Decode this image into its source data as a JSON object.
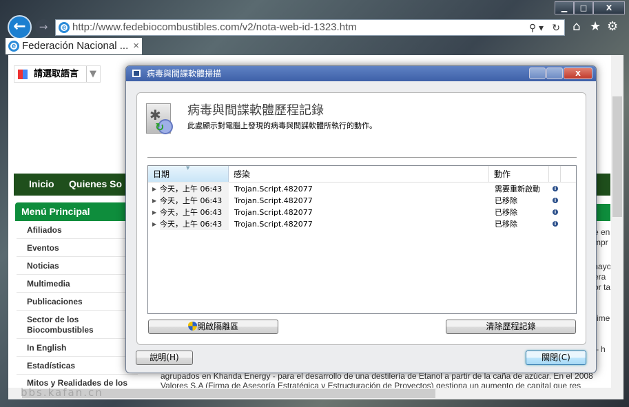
{
  "browser": {
    "url": "http://www.fedebiocombustibles.com/v2/nota-web-id-1323.htm",
    "tab_title": "Federación Nacional ...",
    "tab_close": "×",
    "window_buttons": {
      "minimize": "▁",
      "maximize": "□",
      "close": "X"
    },
    "icons": [
      "back-icon",
      "forward-icon",
      "ie-icon",
      "search-icon",
      "refresh-icon",
      "home-icon",
      "favorites-star-icon",
      "gear-icon"
    ]
  },
  "page": {
    "translate_label": "請選取語言",
    "nav": [
      "Inicio",
      "Quienes So"
    ],
    "menu_title": "Menú Principal",
    "menu_items": [
      "Afiliados",
      "Eventos",
      "Noticias",
      "Multimedia",
      "Publicaciones",
      "Sector de los Biocombustibles",
      "In English",
      "Estadísticas",
      "Mitos y Realidades de los"
    ],
    "right_fragments": [
      "e en",
      "mpr",
      "mayo",
      "era",
      "or ta",
      "rime",
      "– h"
    ],
    "body_lines": [
      "agrupados en Khanda Energy - para el desarrollo de una destilería de Etanol a partir de la caña de azúcar. En el 2008",
      "Valores S.A (Firma de Asesoría Estratégica y Estructuración de Proyectos) gestiona un aumento de capital que res"
    ],
    "watermark": "bbs.kafan.cn"
  },
  "dialog": {
    "title": "病毒與間諜軟體掃描",
    "heading": "病毒與間諜軟體歷程記錄",
    "subtitle": "此處顯示對電腦上發現的病毒與間諜軟體所執行的動作。",
    "columns": [
      "日期",
      "感染",
      "動作"
    ],
    "rows": [
      {
        "date": "今天，上午 06:43",
        "infection": "Trojan.Script.482077",
        "action": "需要重新啟動"
      },
      {
        "date": "今天，上午 06:43",
        "infection": "Trojan.Script.482077",
        "action": "已移除"
      },
      {
        "date": "今天，上午 06:43",
        "infection": "Trojan.Script.482077",
        "action": "已移除"
      },
      {
        "date": "今天，上午 06:43",
        "infection": "Trojan.Script.482077",
        "action": "已移除"
      }
    ],
    "quarantine_button": "開啟隔離區",
    "clear_button": "清除歷程記錄",
    "help_button": "說明(H)",
    "close_button": "關閉(C)"
  },
  "colors": {
    "nav_green": "#1f4f1c",
    "menu_green": "#0e8d3c",
    "dialog_title": "#4a6cb0",
    "close_red": "#c94a3e"
  }
}
